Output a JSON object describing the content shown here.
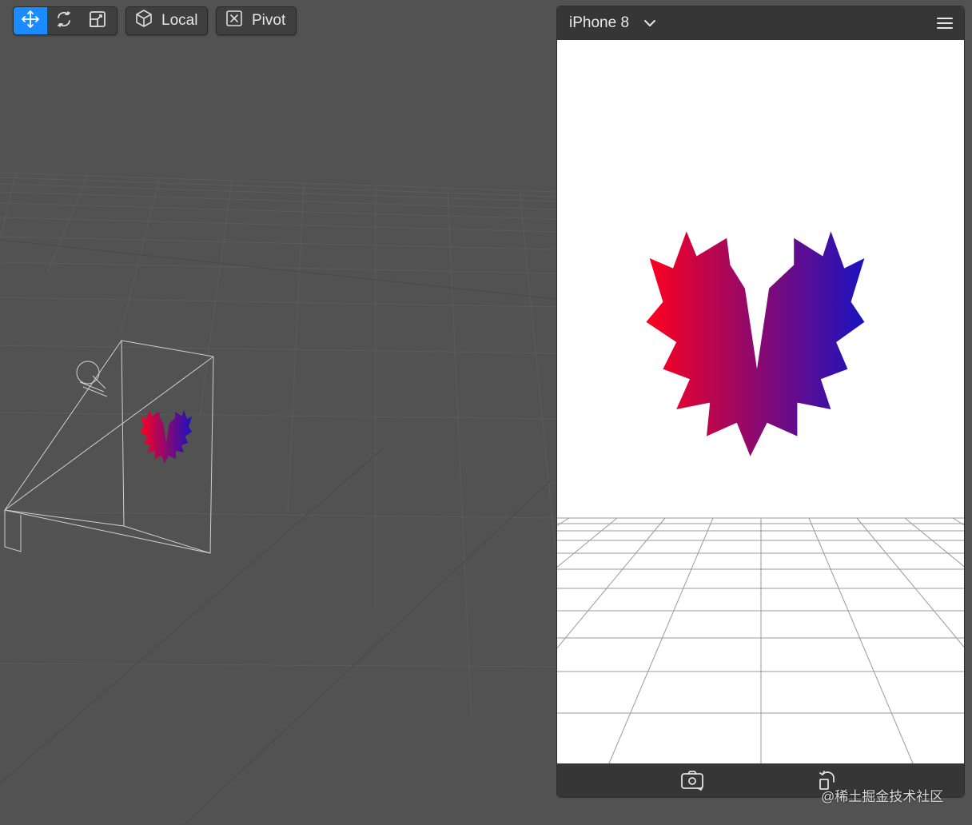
{
  "toolbar": {
    "transform_tools": [
      {
        "name": "move",
        "icon": "move-arrows-icon",
        "active": true
      },
      {
        "name": "rotate",
        "icon": "rotate-icon",
        "active": false
      },
      {
        "name": "scale",
        "icon": "scale-icon",
        "active": false
      }
    ],
    "space_toggle": {
      "icon": "cube-icon",
      "label": "Local"
    },
    "pivot_toggle": {
      "icon": "x-box-icon",
      "label": "Pivot"
    }
  },
  "scene": {
    "objects": [
      "camera-frustum",
      "heart-spiky-shape"
    ],
    "heart_gradient": [
      "#ff001e",
      "#1a12c0"
    ]
  },
  "preview": {
    "device_label": "iPhone 8",
    "device_icon": "chevron-down-icon",
    "menu_icon": "hamburger-icon",
    "footer_buttons": [
      {
        "name": "reset-camera",
        "icon": "camera-rotate-icon"
      },
      {
        "name": "rotate-device",
        "icon": "rotate-device-icon"
      }
    ]
  },
  "watermark": "@稀土掘金技术社区",
  "colors": {
    "accent": "#1a8cff",
    "viewport_bg": "#525252",
    "toolbar_bg": "#3f3f3f",
    "preview_bar": "#363636"
  }
}
